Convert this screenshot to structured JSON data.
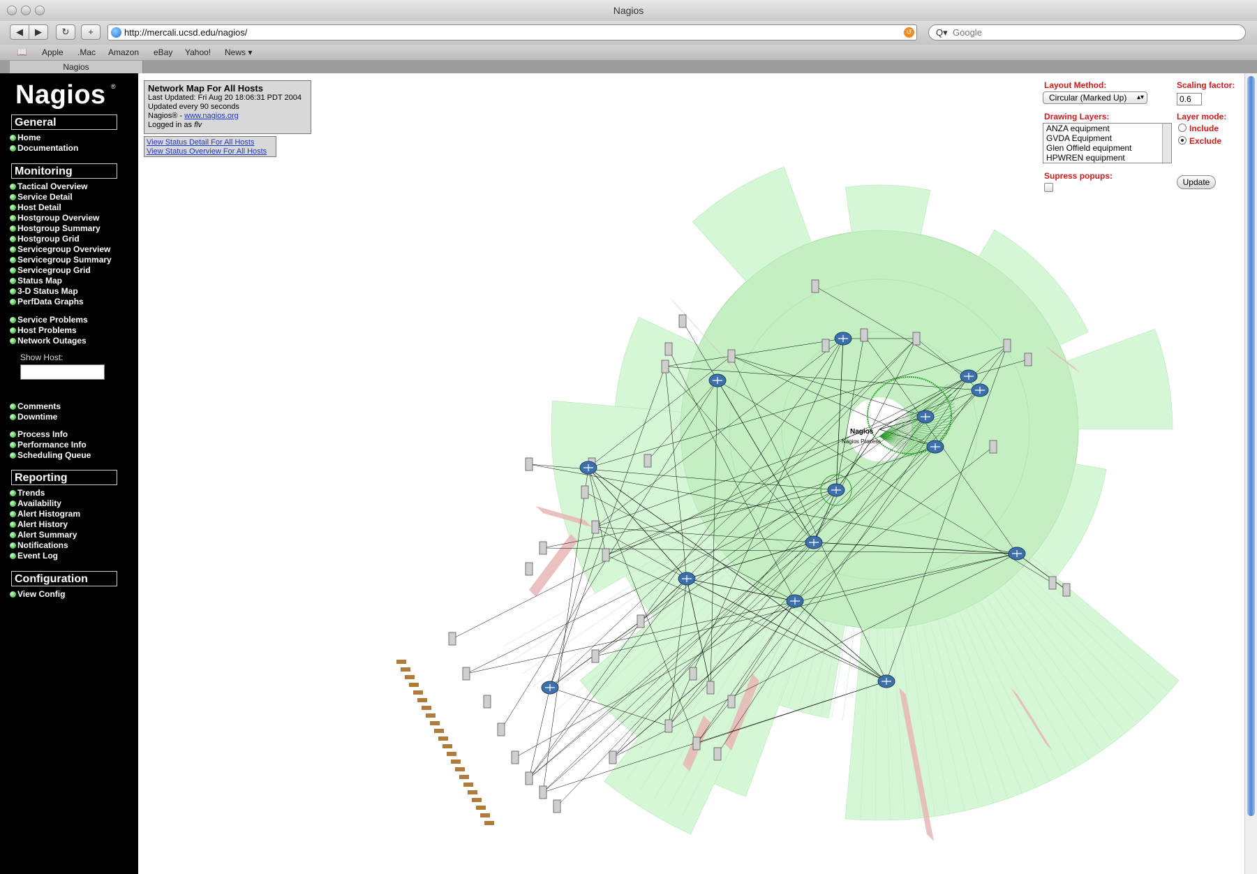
{
  "browser": {
    "window_title": "Nagios",
    "url": "http://mercali.ucsd.edu/nagios/",
    "search_placeholder": "Google",
    "tab_label": "Nagios",
    "bookmarks": [
      "Apple",
      ".Mac",
      "Amazon",
      "eBay",
      "Yahoo!",
      "News ▾"
    ]
  },
  "sidebar": {
    "logo": "Nagios",
    "logo_mark": "®",
    "sections": {
      "general": {
        "title": "General",
        "items": [
          "Home",
          "Documentation"
        ]
      },
      "monitoring": {
        "title": "Monitoring",
        "items": [
          "Tactical Overview",
          "Service Detail",
          "Host Detail",
          "Hostgroup Overview",
          "Hostgroup Summary",
          "Hostgroup Grid",
          "Servicegroup Overview",
          "Servicegroup Summary",
          "Servicegroup Grid",
          "Status Map",
          "3-D Status Map",
          "PerfData Graphs"
        ],
        "problems": [
          "Service Problems",
          "Host Problems",
          "Network Outages"
        ],
        "show_host_label": "Show Host:",
        "extra": [
          "Comments",
          "Downtime"
        ],
        "info": [
          "Process Info",
          "Performance Info",
          "Scheduling Queue"
        ]
      },
      "reporting": {
        "title": "Reporting",
        "items": [
          "Trends",
          "Availability",
          "Alert Histogram",
          "Alert History",
          "Alert Summary",
          "Notifications",
          "Event Log"
        ]
      },
      "configuration": {
        "title": "Configuration",
        "items": [
          "View Config"
        ]
      }
    }
  },
  "info": {
    "title": "Network Map For All Hosts",
    "last_updated": "Last Updated: Fri Aug 20 18:06:31 PDT 2004",
    "update_interval": "Updated every 90 seconds",
    "nagios_prefix": "Nagios® - ",
    "nagios_link": "www.nagios.org",
    "logged_in_prefix": "Logged in as ",
    "user": "flv",
    "link_detail": "View Status Detail For All Hosts",
    "link_overview": "View Status Overview For All Hosts"
  },
  "controls": {
    "layout_method_label": "Layout Method:",
    "layout_method_value": "Circular (Marked Up)",
    "scaling_label": "Scaling factor:",
    "scaling_value": "0.6",
    "drawing_layers_label": "Drawing Layers:",
    "layers": [
      "ANZA equipment",
      "GVDA Equipment",
      "Glen Offield equipment",
      "HPWREN equipment"
    ],
    "layer_mode_label": "Layer mode:",
    "include_label": "Include",
    "exclude_label": "Exclude",
    "layer_mode_selected": "Exclude",
    "suppress_label": "Supress popups:",
    "suppress_checked": false,
    "update_label": "Update"
  },
  "map": {
    "center_label": "Nagios",
    "center_sublabel": "Nagios Process",
    "colors": {
      "up": "#d6f7d6",
      "down": "#e8b5b5",
      "link": "#000000",
      "ring": "#c3efc3"
    }
  }
}
